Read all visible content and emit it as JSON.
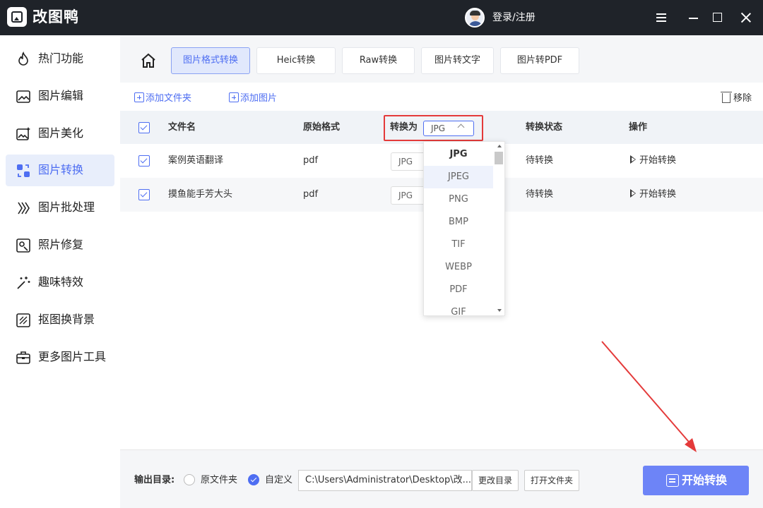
{
  "app": {
    "title": "改图鸭",
    "login": "登录/注册"
  },
  "sidebar": {
    "items": [
      {
        "label": "热门功能",
        "icon": "flame-icon"
      },
      {
        "label": "图片编辑",
        "icon": "image-edit-icon"
      },
      {
        "label": "图片美化",
        "icon": "image-beautify-icon"
      },
      {
        "label": "图片转换",
        "icon": "image-convert-icon",
        "active": true
      },
      {
        "label": "图片批处理",
        "icon": "batch-icon"
      },
      {
        "label": "照片修复",
        "icon": "photo-repair-icon"
      },
      {
        "label": "趣味特效",
        "icon": "magic-wand-icon"
      },
      {
        "label": "抠图换背景",
        "icon": "cutout-icon"
      },
      {
        "label": "更多图片工具",
        "icon": "toolbox-icon"
      }
    ]
  },
  "tabs": [
    "图片格式转换",
    "Heic转换",
    "Raw转换",
    "图片转文字",
    "图片转PDF"
  ],
  "toolbar": {
    "add_folder": "添加文件夹",
    "add_image": "添加图片",
    "remove": "移除"
  },
  "table": {
    "headers": {
      "name": "文件名",
      "format": "原始格式",
      "convert_to": "转换为",
      "status": "转换状态",
      "action": "操作"
    },
    "header_select": "JPG",
    "rows": [
      {
        "name": "案例英语翻译",
        "format": "pdf",
        "target": "JPG",
        "status": "待转换",
        "action": "开始转换"
      },
      {
        "name": "摸鱼能手芳大头",
        "format": "pdf",
        "target": "JPG",
        "status": "待转换",
        "action": "开始转换"
      }
    ]
  },
  "dropdown": {
    "options": [
      "JPG",
      "JPEG",
      "PNG",
      "BMP",
      "TIF",
      "WEBP",
      "PDF",
      "GIF"
    ],
    "selected": "JPG",
    "hovered": "JPEG"
  },
  "output": {
    "label": "输出目录:",
    "option_original": "原文件夹",
    "option_custom": "自定义",
    "path": "C:\\Users\\Administrator\\Desktop\\改...",
    "change_dir": "更改目录",
    "open_folder": "打开文件夹",
    "start": "开始转换"
  },
  "colors": {
    "accent": "#4e6ef2",
    "titlebar": "#1f2329",
    "highlight": "#e43a3a",
    "start_button": "#6d84f7"
  }
}
